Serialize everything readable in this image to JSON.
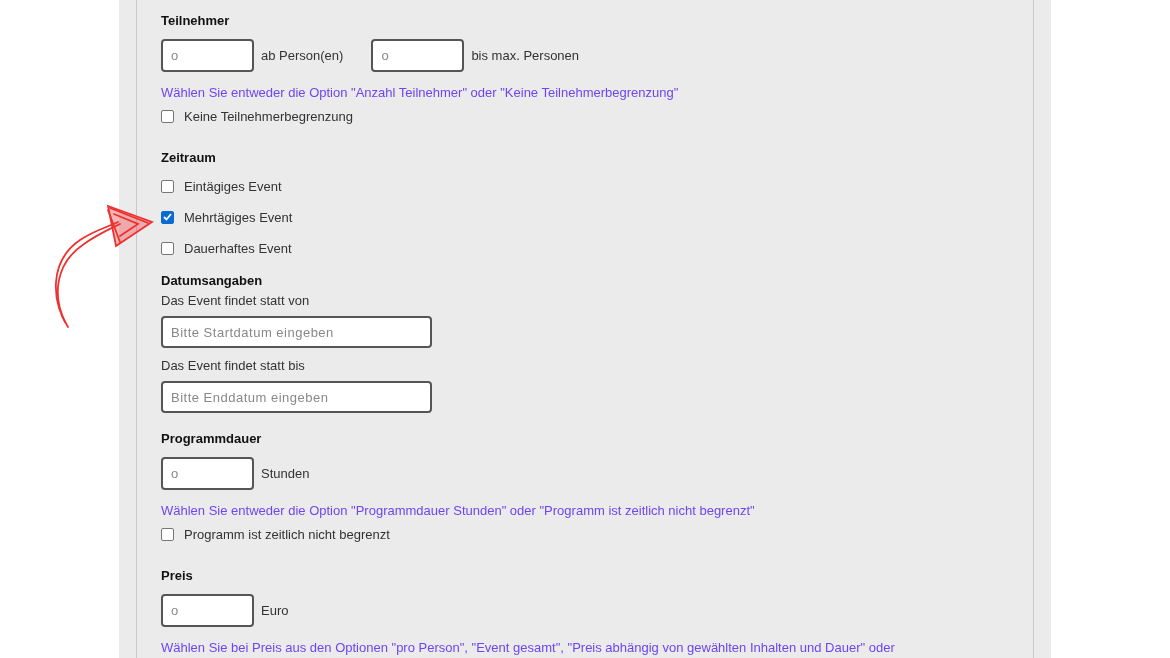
{
  "form": [
    {
      "kind": "heading",
      "text": "Teilnehmer"
    },
    {
      "kind": "fields",
      "fields": [
        {
          "placeholder": "o",
          "unit": "ab Person(en)"
        },
        {
          "placeholder": "o",
          "unit": "bis max. Personen"
        }
      ]
    },
    {
      "kind": "hint",
      "text": "Wählen Sie entweder die Option \"Anzahl Teilnehmer\" oder \"Keine Teilnehmerbegrenzung\""
    },
    {
      "kind": "checkbox",
      "label": "Keine Teilnehmerbegrenzung",
      "checked": false
    },
    {
      "kind": "heading",
      "text": "Zeitraum"
    },
    {
      "kind": "checkbox",
      "label": "Eintägiges Event",
      "checked": false
    },
    {
      "kind": "checkbox",
      "label": "Mehrtägiges Event",
      "checked": true
    },
    {
      "kind": "checkbox",
      "label": "Dauerhaftes Event",
      "checked": false
    },
    {
      "kind": "subheading",
      "text": "Datumsangaben"
    },
    {
      "kind": "label",
      "text": "Das Event findet statt von"
    },
    {
      "kind": "date",
      "placeholder": "Bitte Startdatum eingeben"
    },
    {
      "kind": "label",
      "text": "Das Event findet statt bis"
    },
    {
      "kind": "date",
      "placeholder": "Bitte Enddatum eingeben"
    },
    {
      "kind": "heading",
      "text": "Programmdauer"
    },
    {
      "kind": "fields",
      "fields": [
        {
          "placeholder": "o",
          "unit": "Stunden"
        }
      ]
    },
    {
      "kind": "hint",
      "text": "Wählen Sie entweder die Option \"Programmdauer Stunden\" oder \"Programm ist zeitlich nicht begrenzt\""
    },
    {
      "kind": "checkbox",
      "label": "Programm ist zeitlich nicht begrenzt",
      "checked": false
    },
    {
      "kind": "heading",
      "text": "Preis"
    },
    {
      "kind": "fields",
      "fields": [
        {
          "placeholder": "o",
          "unit": "Euro"
        }
      ]
    },
    {
      "kind": "hint",
      "text": "Wählen Sie bei Preis aus den Optionen \"pro Person\", \"Event gesamt\", \"Preis abhängig von gewählten Inhalten und Dauer\" oder"
    }
  ]
}
